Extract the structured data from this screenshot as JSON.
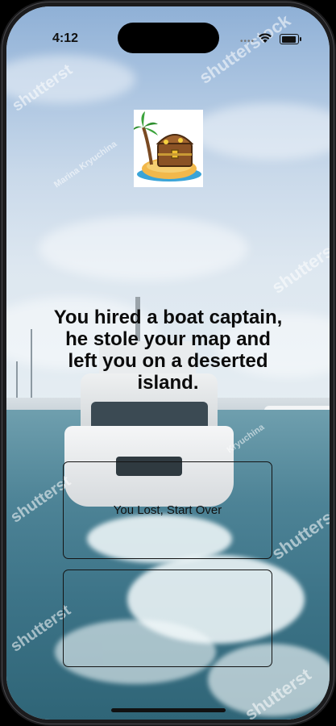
{
  "status_bar": {
    "time": "4:12"
  },
  "story": {
    "text": "You hired a boat captain, he stole your map and left you on a deserted island."
  },
  "choices": [
    {
      "label": "You Lost, Start Over"
    },
    {
      "label": ""
    }
  ],
  "logo": {
    "icon": "treasure-island-icon"
  },
  "background": {
    "image": "yacht-photo",
    "watermark_texts": [
      "shutterstock",
      "shutterst",
      "Marina Kryuchina",
      "Kryuchina"
    ]
  }
}
